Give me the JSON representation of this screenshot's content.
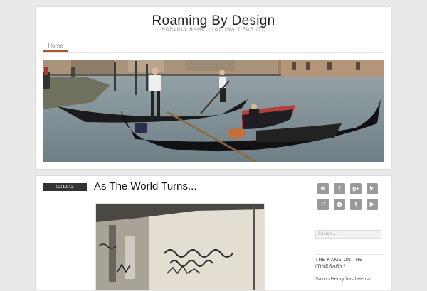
{
  "site": {
    "title": "Roaming By Design",
    "tagline": "WORLDLY RAMBLINGS (WAIT FOR IT!)"
  },
  "nav": {
    "items": [
      {
        "label": "Home",
        "active": true
      }
    ]
  },
  "hero": {
    "alt": "Gondolas on the Grand Canal in Venice"
  },
  "post": {
    "date": "02/19/13",
    "title": "As The World Turns...",
    "image_alt": "Graffiti-covered underpass wall"
  },
  "sidebar": {
    "social": [
      {
        "name": "email-icon",
        "glyph": "✉"
      },
      {
        "name": "facebook-icon",
        "glyph": "f"
      },
      {
        "name": "google-plus-icon",
        "glyph": "g+"
      },
      {
        "name": "linkedin-icon",
        "glyph": "in"
      },
      {
        "name": "pinterest-icon",
        "glyph": "P"
      },
      {
        "name": "rss-icon",
        "glyph": "◉"
      },
      {
        "name": "twitter-icon",
        "glyph": "t"
      },
      {
        "name": "youtube-icon",
        "glyph": "▶"
      }
    ],
    "search_placeholder": "Search ...",
    "widget_title": "THE NAME ON THE ITINERARY?",
    "widget_text": "Saxon Henry has been a"
  },
  "colors": {
    "accent": "#b5522d",
    "date_badge": "#333333",
    "social_icon": "#9a9a9a"
  }
}
